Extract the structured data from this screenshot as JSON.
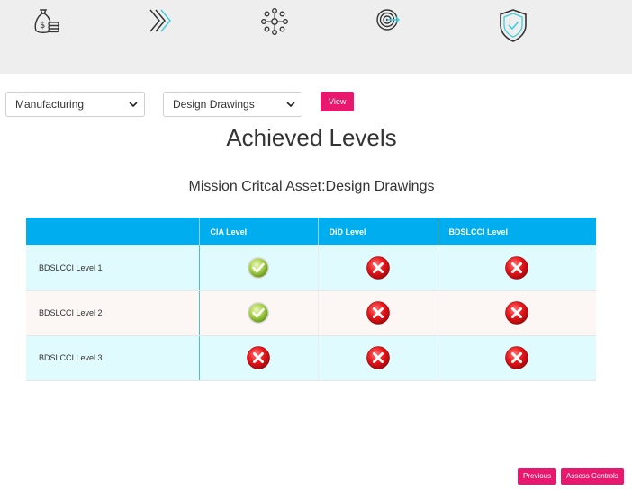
{
  "steps": [
    {
      "icon": "money-bag-icon"
    },
    {
      "icon": "chevrons-right-icon"
    },
    {
      "icon": "network-nodes-icon"
    },
    {
      "icon": "target-icon"
    },
    {
      "icon": "shield-check-icon"
    }
  ],
  "filters": {
    "sector": {
      "selected": "Manufacturing"
    },
    "asset": {
      "selected": "Design Drawings"
    },
    "view_label": "View"
  },
  "title": "Achieved Levels",
  "subtitle": "Mission Critcal Asset:Design Drawings",
  "table": {
    "headers": [
      "",
      "CIA Level",
      "DiD Level",
      "BDSLCCI Level"
    ],
    "rows": [
      {
        "label": "BDSLCCI Level 1",
        "cia": "pass",
        "did": "fail",
        "bdslcci": "fail"
      },
      {
        "label": "BDSLCCI Level 2",
        "cia": "pass",
        "did": "fail",
        "bdslcci": "fail"
      },
      {
        "label": "BDSLCCI Level 3",
        "cia": "fail",
        "did": "fail",
        "bdslcci": "fail"
      }
    ]
  },
  "footer": {
    "previous_label": "Previous",
    "assess_label": "Assess Controls"
  },
  "colors": {
    "accent": "#e8186e",
    "header_blue": "#00aef0",
    "row_cyan": "#e0fbfd",
    "pass_green": "#8cc63f",
    "fail_red": "#e8161b"
  }
}
